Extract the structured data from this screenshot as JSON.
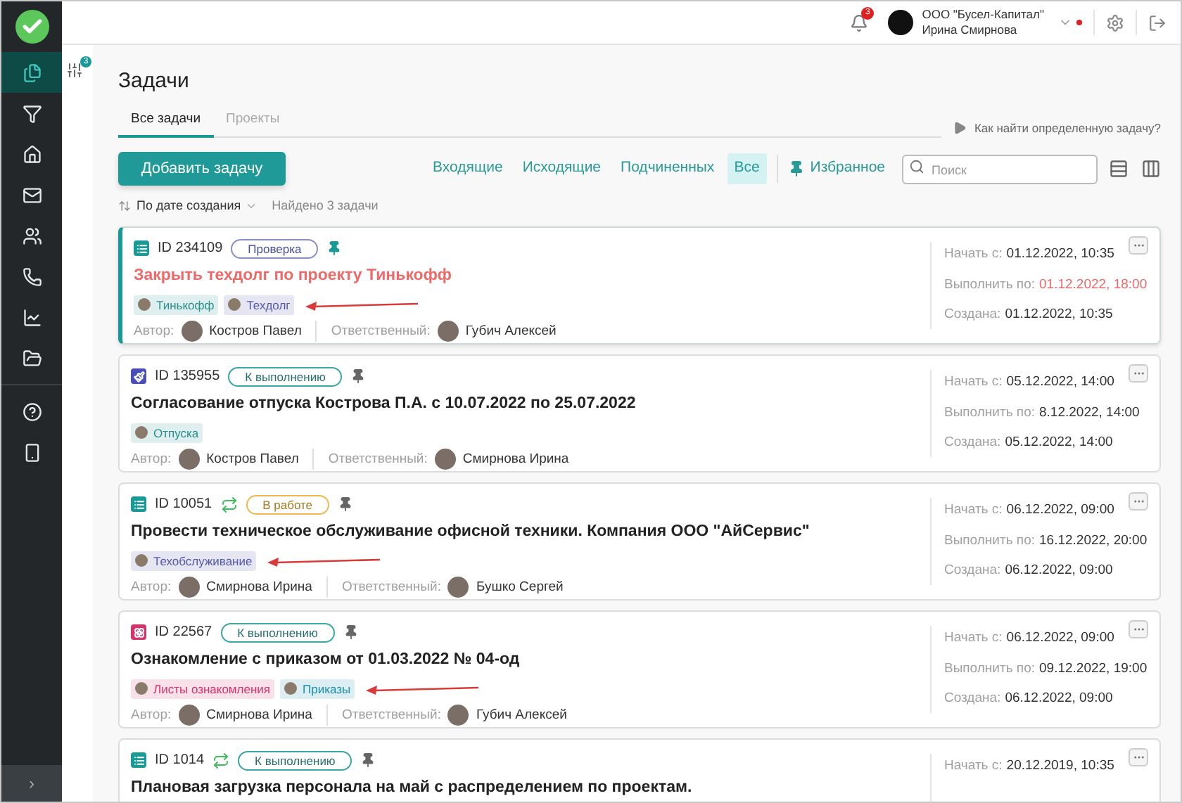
{
  "sidebar": {
    "items": [
      {
        "kind": "documents",
        "selected": true
      },
      {
        "kind": "funnel",
        "selected": false
      },
      {
        "kind": "home",
        "selected": false
      },
      {
        "kind": "mail",
        "selected": false
      },
      {
        "kind": "users",
        "selected": false
      },
      {
        "kind": "phone",
        "selected": false
      },
      {
        "kind": "chart",
        "selected": false
      },
      {
        "kind": "folder",
        "selected": false
      },
      {
        "kind": "divider"
      },
      {
        "kind": "help",
        "selected": false
      },
      {
        "kind": "mobile",
        "selected": false
      }
    ],
    "collapse": "›"
  },
  "filter_badge": "3",
  "header": {
    "notification_count": "3",
    "company": "ООО \"Бусел-Капитал\"",
    "user": "Ирина Смирнова",
    "alert": true
  },
  "page_title": "Задачи",
  "tabs": [
    {
      "label": "Все задачи",
      "selected": true
    },
    {
      "label": "Проекты",
      "selected": false
    }
  ],
  "help_link": "Как найти определенную задачу?",
  "add_button": "Добавить задачу",
  "filters": [
    {
      "label": "Входящие",
      "selected": false
    },
    {
      "label": "Исходящие",
      "selected": false
    },
    {
      "label": "Подчиненных",
      "selected": false
    },
    {
      "label": "Все",
      "selected": true
    }
  ],
  "favorites": "Избранное",
  "search": {
    "placeholder": "Поиск"
  },
  "sort": {
    "label": "По дате создания",
    "found": "Найдено 3 задачи"
  },
  "tasks": [
    {
      "selected": true,
      "icon": {
        "kind": "list",
        "color": "#1a9a96"
      },
      "id": "ID 234109",
      "recurring": false,
      "status": {
        "label": "Проверка",
        "kind": "review"
      },
      "pinned": true,
      "title": "Закрыть техдолг по проекту Тинькофф",
      "overdue": true,
      "tags": [
        {
          "label": "Тинькофф",
          "color": "#2a8f8f"
        },
        {
          "label": "Техдолг",
          "color": "#5458b0",
          "arrow": true
        }
      ],
      "people": [
        {
          "label": "Автор:",
          "name": "Костров Павел"
        },
        {
          "label": "Ответственный:",
          "name": "Губич Алексей"
        }
      ],
      "dates": [
        {
          "label": "Начать с:",
          "value": "01.12.2022, 10:35",
          "overdue": false
        },
        {
          "label": "Выполнить по:",
          "value": "01.12.2022, 18:00",
          "overdue": true
        },
        {
          "label": "Создана:",
          "value": "01.12.2022, 10:35",
          "overdue": false
        }
      ]
    },
    {
      "selected": false,
      "icon": {
        "kind": "brush",
        "color": "#4a4fb8"
      },
      "id": "ID 135955",
      "recurring": false,
      "status": {
        "label": "К выполнению",
        "kind": "todo"
      },
      "pinned": false,
      "title": "Согласование отпуска Кострова П.А. с 10.07.2022 по 25.07.2022",
      "overdue": false,
      "tags": [
        {
          "label": "Отпуска",
          "color": "#2a8f8f"
        }
      ],
      "people": [
        {
          "label": "Автор:",
          "name": "Костров Павел"
        },
        {
          "label": "Ответственный:",
          "name": "Смирнова Ирина"
        }
      ],
      "dates": [
        {
          "label": "Начать с:",
          "value": "05.12.2022, 14:00",
          "overdue": false
        },
        {
          "label": "Выполнить по:",
          "value": "8.12.2022, 14:00",
          "overdue": false
        },
        {
          "label": "Создана:",
          "value": "05.12.2022, 14:00",
          "overdue": false
        }
      ]
    },
    {
      "selected": false,
      "icon": {
        "kind": "list",
        "color": "#1a9a96"
      },
      "id": "ID 10051",
      "recurring": true,
      "status": {
        "label": "В работе",
        "kind": "progress"
      },
      "pinned": false,
      "title": "Провести техническое обслуживание офисной техники. Компания ООО \"АйСервис\"",
      "overdue": false,
      "tags": [
        {
          "label": "Техобслуживание",
          "color": "#5458b0",
          "arrow": true
        }
      ],
      "people": [
        {
          "label": "Автор:",
          "name": "Смирнова Ирина"
        },
        {
          "label": "Ответственный:",
          "name": "Бушко Сергей"
        }
      ],
      "dates": [
        {
          "label": "Начать с:",
          "value": "06.12.2022, 09:00",
          "overdue": false
        },
        {
          "label": "Выполнить по:",
          "value": "16.12.2022, 20:00",
          "overdue": false
        },
        {
          "label": "Создана:",
          "value": "06.12.2022, 09:00",
          "overdue": false
        }
      ]
    },
    {
      "selected": false,
      "icon": {
        "kind": "flower",
        "color": "#d6336c"
      },
      "id": "ID 22567",
      "recurring": false,
      "status": {
        "label": "К выполнению",
        "kind": "todo"
      },
      "pinned": false,
      "title": "Ознакомление с приказом от 01.03.2022 № 04-од",
      "overdue": false,
      "tags": [
        {
          "label": "Листы ознакомления",
          "color": "#d6336c"
        },
        {
          "label": "Приказы",
          "color": "#1a8fb0",
          "arrow": true
        }
      ],
      "people": [
        {
          "label": "Автор:",
          "name": "Смирнова Ирина"
        },
        {
          "label": "Ответственный:",
          "name": "Губич Алексей"
        }
      ],
      "dates": [
        {
          "label": "Начать с:",
          "value": "06.12.2022, 09:00",
          "overdue": false
        },
        {
          "label": "Выполнить по:",
          "value": "09.12.2022, 19:00",
          "overdue": false
        },
        {
          "label": "Создана:",
          "value": "06.12.2022, 09:00",
          "overdue": false
        }
      ]
    },
    {
      "selected": false,
      "icon": {
        "kind": "list",
        "color": "#1a9a96"
      },
      "id": "ID 1014",
      "recurring": true,
      "status": {
        "label": "К выполнению",
        "kind": "todo"
      },
      "pinned": false,
      "title": "Плановая загрузка персонала на май с распределением по проектам.",
      "overdue": false,
      "dates": [
        {
          "label": "Начать с:",
          "value": "20.12.2019, 10:35",
          "overdue": false
        }
      ]
    }
  ]
}
